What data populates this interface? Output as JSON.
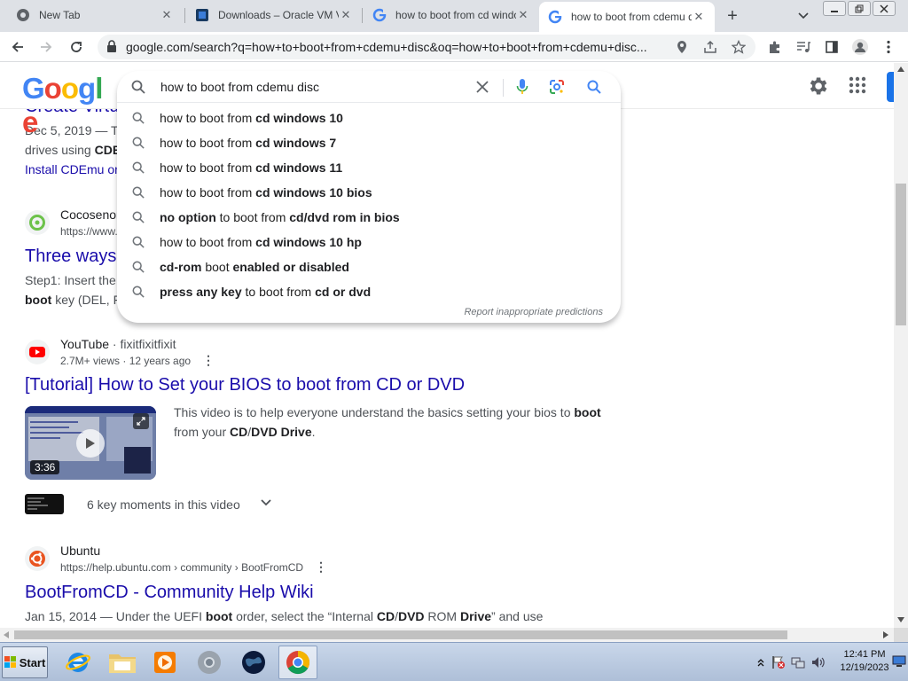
{
  "browser": {
    "tabs": [
      {
        "title": "New Tab",
        "favicon": "chrome-icon"
      },
      {
        "title": "Downloads – Oracle VM Virt",
        "favicon": "virtualbox-icon"
      },
      {
        "title": "how to boot from cd windo",
        "favicon": "google-icon"
      },
      {
        "title": "how to boot from cdemu di",
        "favicon": "google-icon"
      }
    ],
    "active_tab_index": 3,
    "url": "google.com/search?q=how+to+boot+from+cdemu+disc&oq=how+to+boot+from+cdemu+disc..."
  },
  "google": {
    "logo_letters": [
      "G",
      "o",
      "o",
      "g",
      "l",
      "e"
    ],
    "logo_colors": [
      "#4285f4",
      "#ea4335",
      "#fbbc05",
      "#4285f4",
      "#34a853",
      "#ea4335"
    ],
    "query": "how to boot from cdemu disc",
    "suggestions": [
      {
        "plain": "how to boot from ",
        "bold": "cd windows 10",
        "plain2": "",
        "bold2": ""
      },
      {
        "plain": "how to boot from ",
        "bold": "cd windows 7",
        "plain2": "",
        "bold2": ""
      },
      {
        "plain": "how to boot from ",
        "bold": "cd windows 11",
        "plain2": "",
        "bold2": ""
      },
      {
        "plain": "how to boot from ",
        "bold": "cd windows 10 bios",
        "plain2": "",
        "bold2": ""
      },
      {
        "bold_first": "no option",
        "plain": " to boot from ",
        "bold": "cd/dvd rom in bios"
      },
      {
        "plain": "how to boot from ",
        "bold": "cd windows 10 hp",
        "plain2": "",
        "bold2": ""
      },
      {
        "bold_first": "cd-rom",
        "plain": " boot ",
        "bold": "enabled or disabled"
      },
      {
        "bold_first": "press any key",
        "plain": " to boot from ",
        "bold": "cd or dvd"
      }
    ],
    "report_text": "Report inappropriate predictions"
  },
  "results": {
    "r0": {
      "title_partial": "Create Virtu",
      "date": "Dec 5, 2019 — T",
      "line2_plain": "drives using ",
      "line2_bold": "CDE",
      "link": "Install CDEmu or"
    },
    "r1": {
      "site": "Cocosenor",
      "url": "https://www.",
      "title_partial": "Three ways",
      "snip1": "Step1: Insert the",
      "snip2_bold": "boot",
      "snip2_plain": " key (DEL, F"
    },
    "r2": {
      "site": "YouTube",
      "channel": "· fixitfixitfixit",
      "meta": "2.7M+ views · 12 years ago",
      "title": "[Tutorial] How to Set your BIOS to boot from CD or DVD",
      "desc_a": "This video is to help everyone understand the basics setting your bios to ",
      "desc_b": "boot",
      "desc_c": "from your ",
      "desc_d": "CD",
      "desc_e": "/",
      "desc_f": "DVD Drive",
      "desc_g": ".",
      "duration": "3:36",
      "key_moments": "6 key moments in this video"
    },
    "r3": {
      "site": "Ubuntu",
      "url": "https://help.ubuntu.com › community › BootFromCD",
      "title": "BootFromCD - Community Help Wiki",
      "snip_a": "Jan 15, 2014 — Under the UEFI ",
      "snip_b": "boot",
      "snip_c": " order, select the “Internal ",
      "snip_d": "CD",
      "snip_e": "/",
      "snip_f": "DVD",
      "snip_g": " ROM ",
      "snip_h": "Drive",
      "snip_i": "” and use"
    }
  },
  "taskbar": {
    "start_label": "Start",
    "apps": [
      "internet-explorer-icon",
      "folder-icon",
      "media-player-icon",
      "chrome-gray-icon",
      "earth-icon",
      "chrome-icon"
    ],
    "time": "12:41 PM",
    "date": "12/19/2023"
  }
}
